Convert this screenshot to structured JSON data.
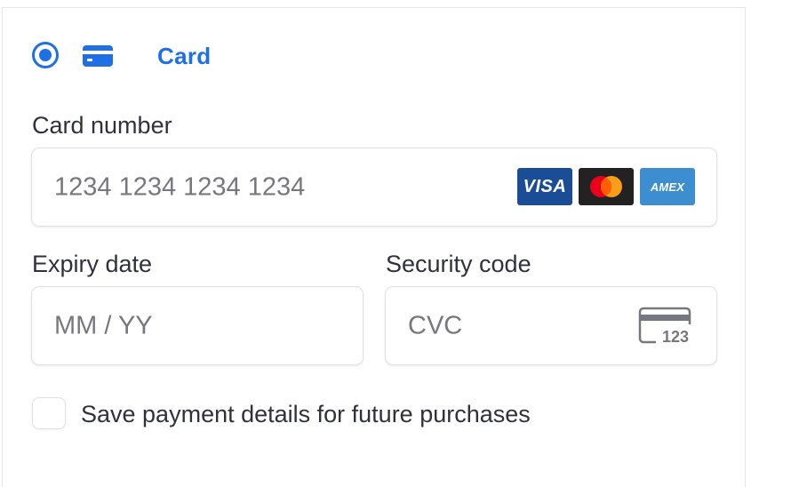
{
  "payment_method": {
    "label": "Card",
    "selected": true,
    "icon": "credit-card-icon",
    "accent_color": "#1f6fe5"
  },
  "card_number": {
    "label": "Card number",
    "placeholder": "1234 1234 1234 1234",
    "brands": [
      {
        "name": "visa-logo",
        "text": "VISA",
        "color": "#1a4d96"
      },
      {
        "name": "mastercard-logo",
        "text": "",
        "color": "#222222"
      },
      {
        "name": "amex-logo",
        "text": "AMEX",
        "color": "#3d8ed0"
      }
    ]
  },
  "expiry": {
    "label": "Expiry date",
    "placeholder": "MM / YY"
  },
  "security_code": {
    "label": "Security code",
    "placeholder": "CVC",
    "icon_text": "123"
  },
  "save_details": {
    "label": "Save payment details for future purchases",
    "checked": false
  }
}
